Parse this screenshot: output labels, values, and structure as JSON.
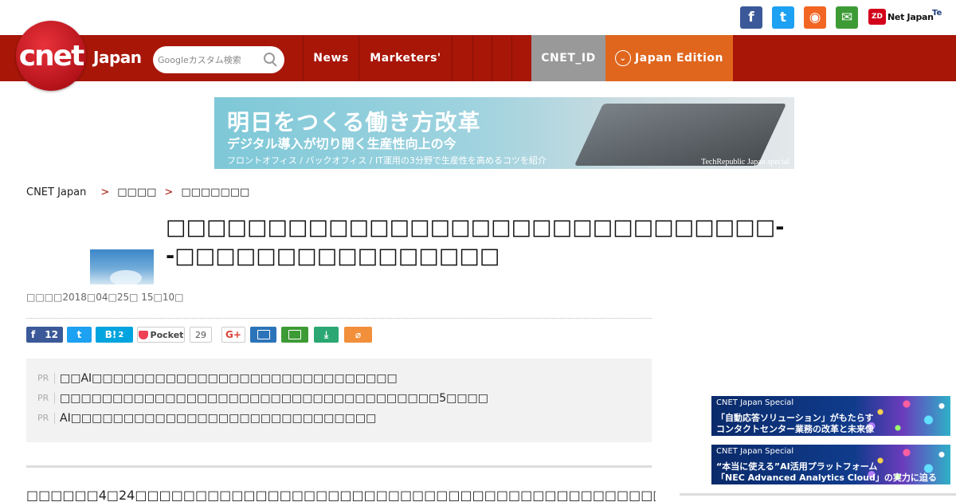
{
  "topbar": {
    "social": {
      "facebook_glyph": "f",
      "twitter_glyph": "t",
      "rss_glyph": "◉",
      "mail_glyph": "✉"
    },
    "zdnet_logo": "ZD",
    "zdnet_text": "Net Japan",
    "techrepublic_text": "Te"
  },
  "header": {
    "logo": "cnet",
    "logo_suffix": "Japan",
    "search_placeholder": "Googleカスタム検索",
    "nav": {
      "news": "News",
      "marketers": "Marketers'",
      "cnet_id": "CNET_ID",
      "japan_edition": "Japan Edition"
    }
  },
  "banner": {
    "headline": "明日をつくる働き方改革",
    "subheadline": "デジタル導入が切り開く生産性向上の今",
    "tagline": "フロントオフィス / バックオフィス / IT運用の3分野で生産性を高めるコツを紹介",
    "brand": "TechRepublic Japan special"
  },
  "breadcrumb": {
    "home": "CNET Japan",
    "level1": "□□□□",
    "level2": "□□□□□□□"
  },
  "article": {
    "title": "□□□□□□□□□□□□□□□□□□□□□□□□□□□□□□--□□□□□□□□□□□□□□□□",
    "date": "□□□□2018□04□25□ 15□10□"
  },
  "share": {
    "facebook_count": "12",
    "hatena_label": "B!",
    "hatena_count": "2",
    "pocket_label": "Pocket",
    "pocket_count": "29",
    "gplus_label": "G+"
  },
  "pr": {
    "tag": "PR",
    "items": [
      "□□AI□□□□□□□□□□□□□□□□□□□□□□□□□□□□□",
      "□□□□□□□□□□□□□□□□□□□□□□□□□□□□□□□□□□□□5□□□□",
      "AI□□□□□□□□□□□□□□□□□□□□□□□□□□□□□"
    ]
  },
  "body": {
    "first_line": "□□□□□□4□24□□□□□□□□□□□□□□□□□□□□□□□□□□□□□□□□□□□□□□□□□□□□□□□□□□□□□"
  },
  "sidebar": {
    "ads": [
      {
        "label": "CNET Japan Special",
        "line1": "「自動応答ソリューション」がもたらす",
        "line2": "コンタクトセンター業務の改革と未来像"
      },
      {
        "label": "CNET Japan Special",
        "line1": "“本当に使える”AI活用プラットフォーム",
        "line2": "「NEC Advanced Analytics Cloud」の実力に迫る"
      }
    ]
  }
}
